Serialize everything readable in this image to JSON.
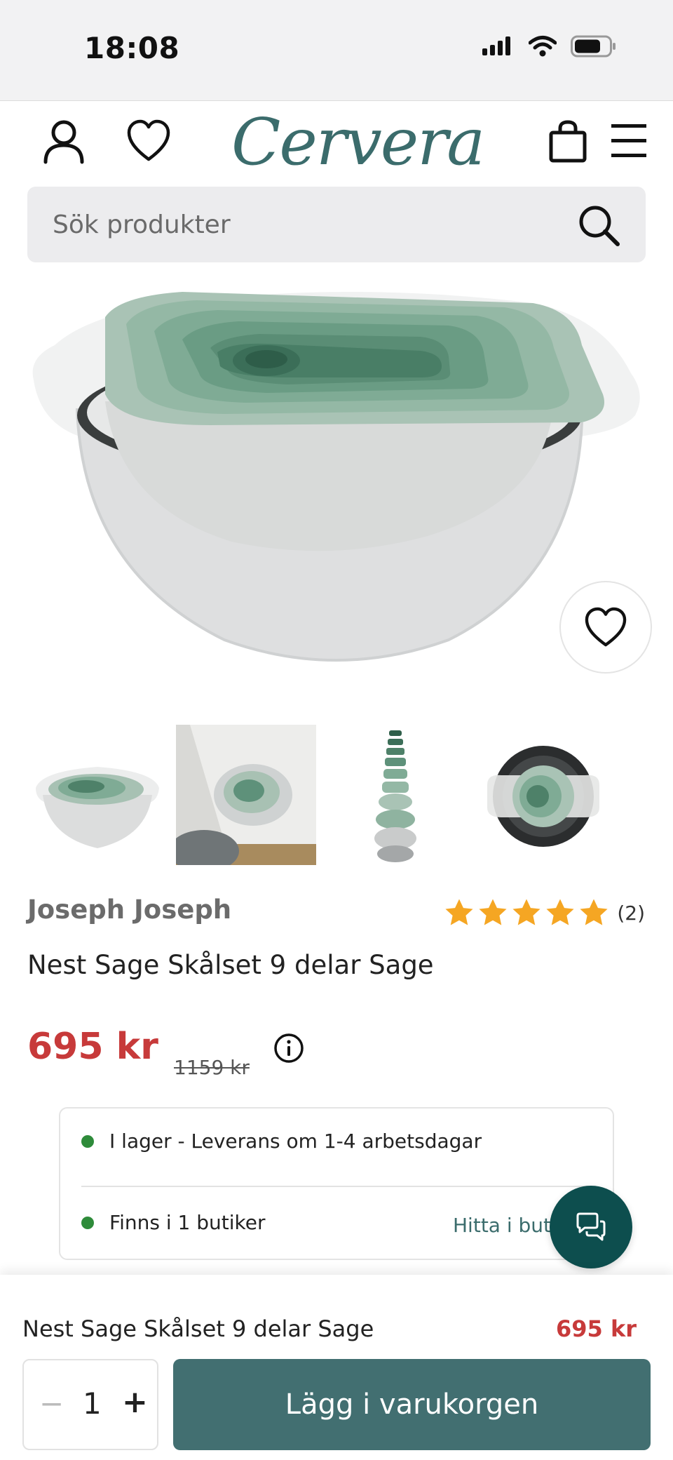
{
  "status_bar": {
    "time": "18:08",
    "icons": [
      "signal-icon",
      "wifi-icon",
      "battery-icon"
    ]
  },
  "header": {
    "brand_logo": "Cervera",
    "icons": [
      "account-icon",
      "wishlist-icon",
      "cart-icon",
      "menu-icon"
    ],
    "accent_color": "#3b6c6c"
  },
  "search": {
    "placeholder": "Sök produkter"
  },
  "product": {
    "brand": "Joseph Joseph",
    "title": "Nest Sage Skålset 9 delar Sage",
    "rating_stars": 5,
    "rating_count": "(2)",
    "price": "695 kr",
    "original_price": "1159 kr",
    "price_color": "#c73a3a",
    "thumbnails": [
      "thumbnail-bowls-front",
      "thumbnail-bowls-drawer",
      "thumbnail-bowls-stacked",
      "thumbnail-bowls-top"
    ]
  },
  "availability": {
    "online_status": "I lager - Leverans om 1-4 arbetsdagar",
    "store_status": "Finns i 1 butiker",
    "find_in_store": "Hitta i butik",
    "status_color": "#2e8b3a"
  },
  "sticky_bar": {
    "title": "Nest Sage Skålset 9 delar Sage",
    "price": "695 kr",
    "quantity_decrease": "−",
    "quantity": "1",
    "quantity_increase": "+",
    "add_to_cart": "Lägg i varukorgen",
    "button_color": "#426f71"
  }
}
